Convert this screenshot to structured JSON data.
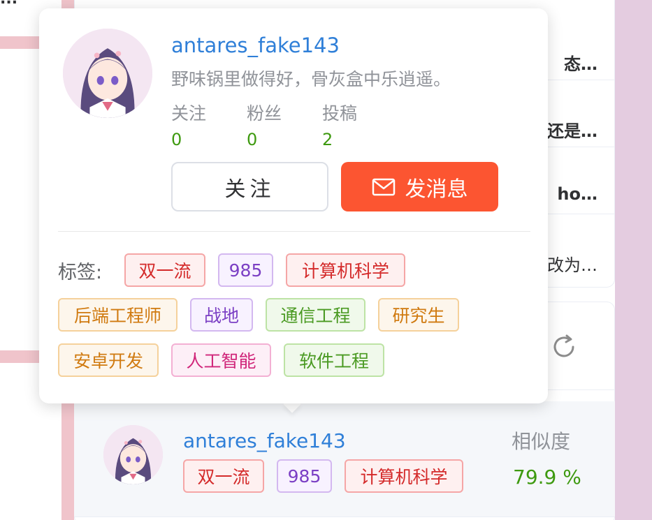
{
  "background": {
    "articles": [
      {
        "title": "态…",
        "bold": true
      },
      {
        "title": "还是…",
        "bold": true
      },
      {
        "title": "ho…",
        "bold": true
      },
      {
        "title": "改为…",
        "bold": false
      }
    ],
    "left_ellipsis": "..."
  },
  "popover": {
    "username": "antares_fake143",
    "bio": "野味锅里做得好，骨灰盒中乐逍遥。",
    "stats": [
      {
        "label": "关注",
        "value": "0"
      },
      {
        "label": "粉丝",
        "value": "0"
      },
      {
        "label": "投稿",
        "value": "2"
      }
    ],
    "follow_label": "关注",
    "message_label": "发消息",
    "tags_label": "标签:",
    "tags": [
      {
        "text": "双一流",
        "color": "red"
      },
      {
        "text": "985",
        "color": "purple"
      },
      {
        "text": "计算机科学",
        "color": "red"
      },
      {
        "text": "后端工程师",
        "color": "orange"
      },
      {
        "text": "战地",
        "color": "purple"
      },
      {
        "text": "通信工程",
        "color": "green"
      },
      {
        "text": "研究生",
        "color": "orange"
      },
      {
        "text": "安卓开发",
        "color": "orange"
      },
      {
        "text": "人工智能",
        "color": "pink"
      },
      {
        "text": "软件工程",
        "color": "green"
      }
    ]
  },
  "similar_user": {
    "username": "antares_fake143",
    "tags": [
      {
        "text": "双一流",
        "color": "red"
      },
      {
        "text": "985",
        "color": "purple"
      },
      {
        "text": "计算机科学",
        "color": "red"
      }
    ],
    "similarity_label": "相似度",
    "similarity_value": "79.9 %"
  },
  "colors": {
    "accent": "#2f7fd8",
    "message_button": "#fc5531",
    "stat_value": "#3e9a10"
  }
}
